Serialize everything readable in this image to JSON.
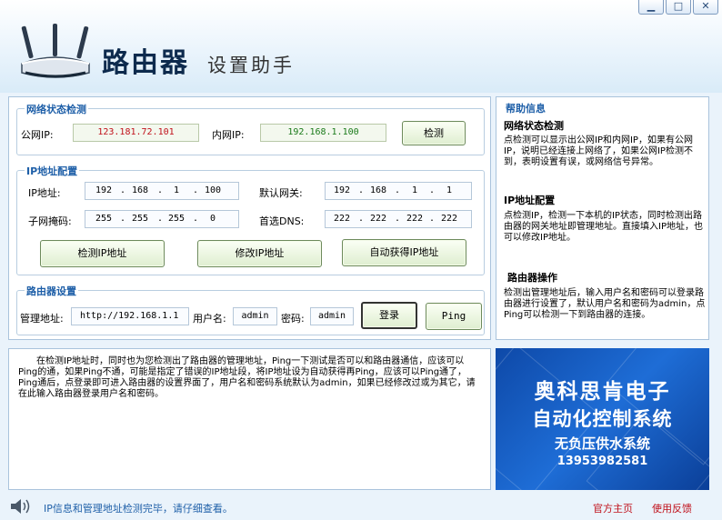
{
  "window": {
    "minimize": "▁",
    "maximize": "□",
    "close": "✕"
  },
  "header": {
    "title": "路由器",
    "subtitle": "设置助手"
  },
  "network_status": {
    "title": "网络状态检测",
    "public_ip_label": "公网IP:",
    "public_ip": "123.181.72.101",
    "private_ip_label": "内网IP:",
    "private_ip": "192.168.1.100",
    "detect_button": "检测"
  },
  "ip_config": {
    "title": "IP地址配置",
    "ip_label": "IP地址:",
    "ip": [
      "192",
      "168",
      "1",
      "100"
    ],
    "gateway_label": "默认网关:",
    "gateway": [
      "192",
      "168",
      "1",
      "1"
    ],
    "mask_label": "子网掩码:",
    "mask": [
      "255",
      "255",
      "255",
      "0"
    ],
    "dns_label": "首选DNS:",
    "dns": [
      "222",
      "222",
      "222",
      "222"
    ],
    "detect_button": "检测IP地址",
    "modify_button": "修改IP地址",
    "auto_button": "自动获得IP地址"
  },
  "router_settings": {
    "title": "路由器设置",
    "admin_url_label": "管理地址:",
    "admin_url": "http://192.168.1.1",
    "username_label": "用户名:",
    "username": "admin",
    "password_label": "密码:",
    "password": "admin",
    "login_button": "登录",
    "ping_button": "Ping"
  },
  "info_text": "　　在检测IP地址时，同时也为您检测出了路由器的管理地址，Ping一下测试是否可以和路由器通信，应该可以Ping的通，如果Ping不通，可能是指定了错误的IP地址段，将IP地址设为自动获得再Ping，应该可以Ping通了，Ping通后，点登录即可进入路由器的设置界面了，用户名和密码系统默认为admin，如果已经修改过或为其它，请在此输入路由器登录用户名和密码。",
  "help": {
    "title": "帮助信息",
    "sections": [
      {
        "heading": "网络状态检测",
        "text": "点检测可以显示出公网IP和内网IP，如果有公网IP，说明已经连接上网络了，如果公网IP检测不到，表明设置有误，或网络信号异常。"
      },
      {
        "heading": "IP地址配置",
        "text": "点检测IP，检测一下本机的IP状态，同时检测出路由器的网关地址即管理地址。直接填入IP地址，也可以修改IP地址。"
      },
      {
        "heading": "路由器操作",
        "text": "检测出管理地址后，输入用户名和密码可以登录路由器进行设置了，默认用户名和密码为admin，点Ping可以检测一下到路由器的连接。"
      }
    ]
  },
  "ad": {
    "line1": "奥科思肯电子",
    "line2": "自动化控制系统",
    "line3": "无负压供水系统",
    "phone": "13953982581"
  },
  "status": {
    "speaker_icon": "speaker-icon",
    "message": "IP信息和管理地址检测完毕，请仔细查看。",
    "official_link": "官方主页",
    "feedback_link": "使用反馈"
  },
  "colors": {
    "accent": "#1e5fa8",
    "link": "#c0101a",
    "public_ip": "#c0101a",
    "private_ip": "#1a7a1a"
  }
}
